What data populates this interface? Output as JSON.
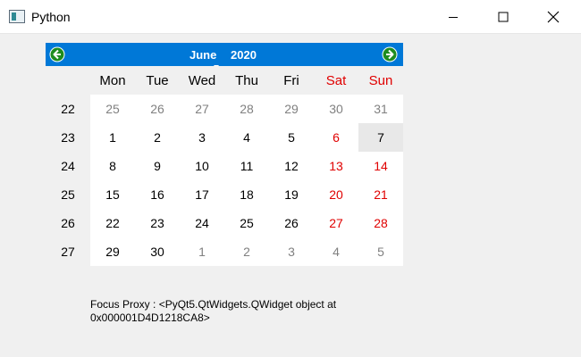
{
  "window": {
    "title": "Python"
  },
  "calendar": {
    "month": "June",
    "year": "2020",
    "day_headers": [
      {
        "label": "Mon",
        "weekend": false
      },
      {
        "label": "Tue",
        "weekend": false
      },
      {
        "label": "Wed",
        "weekend": false
      },
      {
        "label": "Thu",
        "weekend": false
      },
      {
        "label": "Fri",
        "weekend": false
      },
      {
        "label": "Sat",
        "weekend": true
      },
      {
        "label": "Sun",
        "weekend": true
      }
    ],
    "weeks": [
      {
        "week": "22",
        "days": [
          "25",
          "26",
          "27",
          "28",
          "29",
          "30",
          "31"
        ]
      },
      {
        "week": "23",
        "days": [
          "1",
          "2",
          "3",
          "4",
          "5",
          "6",
          "7"
        ]
      },
      {
        "week": "24",
        "days": [
          "8",
          "9",
          "10",
          "11",
          "12",
          "13",
          "14"
        ]
      },
      {
        "week": "25",
        "days": [
          "15",
          "16",
          "17",
          "18",
          "19",
          "20",
          "21"
        ]
      },
      {
        "week": "26",
        "days": [
          "22",
          "23",
          "24",
          "25",
          "26",
          "27",
          "28"
        ]
      },
      {
        "week": "27",
        "days": [
          "29",
          "30",
          "1",
          "2",
          "3",
          "4",
          "5"
        ]
      }
    ],
    "selected_date": "7"
  },
  "focus_proxy": {
    "text": "Focus Proxy  : <PyQt5.QtWidgets.QWidget object at 0x000001D4D1218CA8>"
  },
  "colors": {
    "nav_bar": "#0078d7",
    "weekend": "#e00000",
    "other_month": "#808080",
    "nav_arrow": "#1e8c1e"
  }
}
